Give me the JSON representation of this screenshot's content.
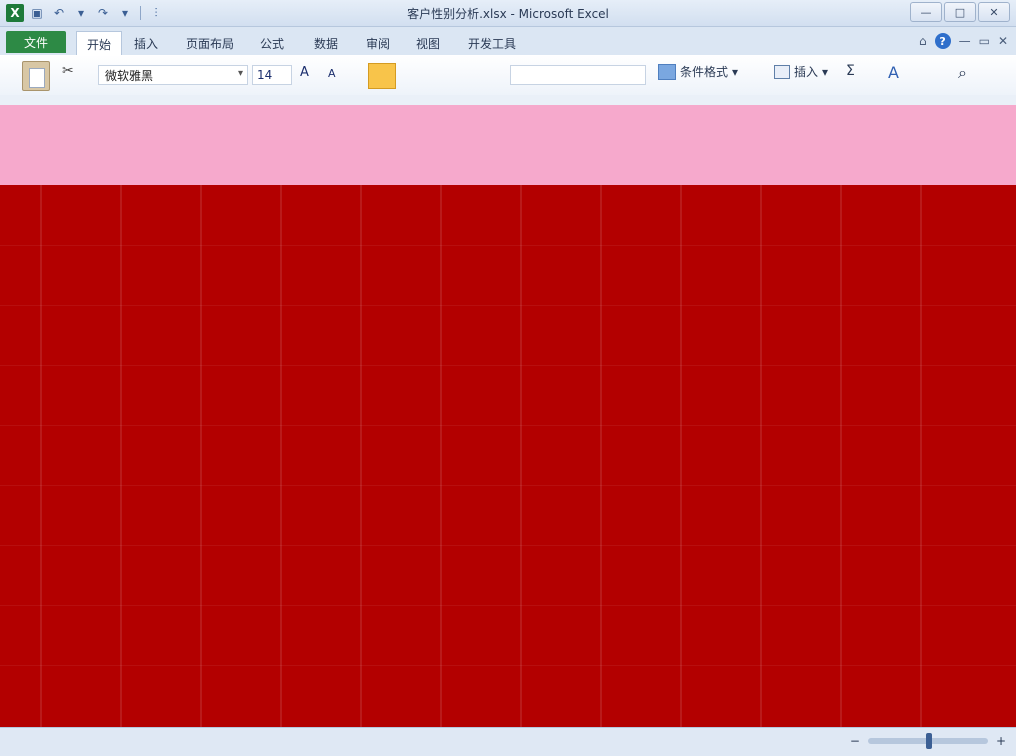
{
  "window": {
    "title": "客户性别分析.xlsx - Microsoft Excel",
    "app_icon_text": "X",
    "controls": {
      "minimize": "—",
      "maximize": "□",
      "close": "✕"
    }
  },
  "qat": {
    "save_icon": "save-icon",
    "undo_icon": "undo-icon",
    "redo_icon": "redo-icon",
    "customize_icon": "customize-icon"
  },
  "tabs": {
    "file": "文件",
    "items": [
      "开始",
      "插入",
      "页面布局",
      "公式",
      "数据",
      "审阅",
      "视图",
      "开发工具"
    ],
    "active": "开始"
  },
  "ribbon": {
    "font_name": "微软雅黑",
    "font_size": "14",
    "conditional_format": "条件格式",
    "insert": "插入",
    "sum": "Σ",
    "dropdown": "▾"
  }
}
